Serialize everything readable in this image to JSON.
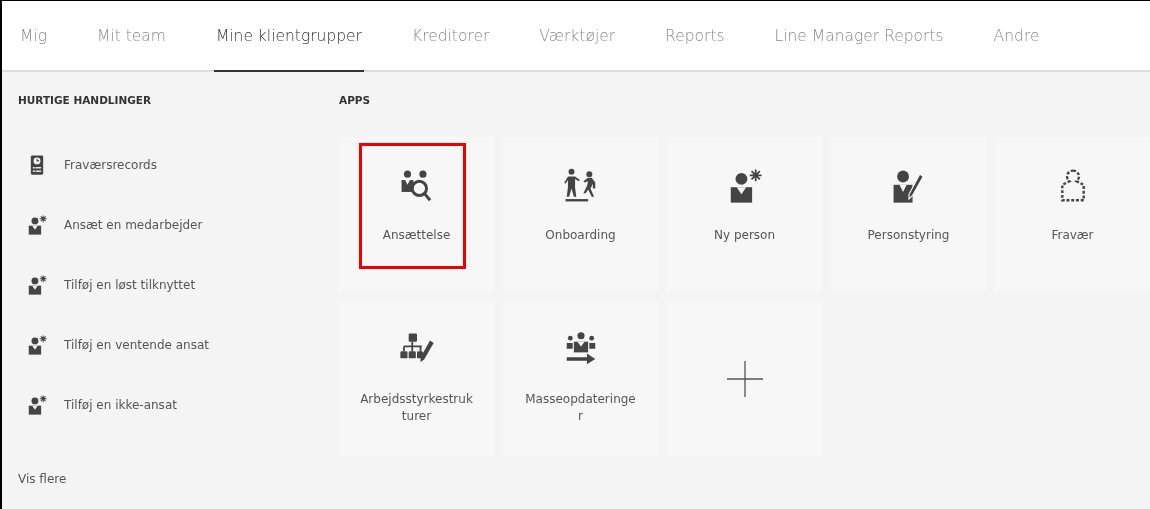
{
  "tabs": [
    {
      "label": "Mig",
      "selected": false
    },
    {
      "label": "Mit team",
      "selected": false
    },
    {
      "label": "Mine klientgrupper",
      "selected": true
    },
    {
      "label": "Kreditorer",
      "selected": false
    },
    {
      "label": "Værktøjer",
      "selected": false
    },
    {
      "label": "Reports",
      "selected": false
    },
    {
      "label": "Line Manager Reports",
      "selected": false
    },
    {
      "label": "Andre",
      "selected": false
    }
  ],
  "quick_actions": {
    "heading": "HURTIGE HANDLINGER",
    "items": [
      {
        "label": "Fraværsrecords",
        "kind": "record"
      },
      {
        "label": "Ansæt en medarbejder",
        "kind": "person-new"
      },
      {
        "label": "Tilføj en løst tilknyttet",
        "kind": "person-new"
      },
      {
        "label": "Tilføj en ventende ansat",
        "kind": "person-new"
      },
      {
        "label": "Tilføj en ikke-ansat",
        "kind": "person-new"
      }
    ],
    "more": "Vis flere"
  },
  "apps": {
    "heading": "APPS",
    "items": [
      {
        "label": "Ansættelse",
        "kind": "hiring",
        "highlighted": true
      },
      {
        "label": "Onboarding",
        "kind": "onboarding",
        "highlighted": false
      },
      {
        "label": "Ny person",
        "kind": "person-new",
        "highlighted": false
      },
      {
        "label": "Personstyring",
        "kind": "person-edit",
        "highlighted": false
      },
      {
        "label": "Fravær",
        "kind": "absence",
        "highlighted": false
      },
      {
        "label": "Arbejdsstyrkestruk\nturer",
        "kind": "structure",
        "highlighted": false
      },
      {
        "label": "Masseopdateringe\nr",
        "kind": "mass-update",
        "highlighted": false
      },
      {
        "kind": "add",
        "highlighted": false
      }
    ]
  }
}
